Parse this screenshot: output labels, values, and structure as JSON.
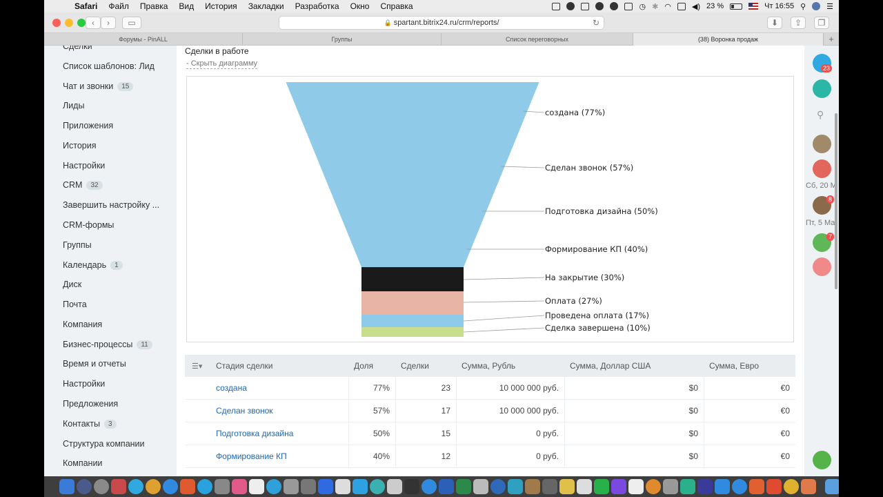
{
  "menubar": {
    "items": [
      "Safari",
      "Файл",
      "Правка",
      "Вид",
      "История",
      "Закладки",
      "Разработка",
      "Окно",
      "Справка"
    ],
    "battery": "23 %",
    "clock": "Чт 16:55"
  },
  "browser": {
    "url": "spartant.bitrix24.ru/crm/reports/",
    "tabs": [
      "Форумы - PinALL",
      "Группы",
      "Список переговорных",
      "(38) Воронка продаж"
    ]
  },
  "sidebar": {
    "items": [
      {
        "label": "Сделки",
        "count": null
      },
      {
        "label": "Список шаблонов: Лид",
        "count": null
      },
      {
        "label": "Чат и звонки",
        "count": "15"
      },
      {
        "label": "Лиды",
        "count": null
      },
      {
        "label": "Приложения",
        "count": null
      },
      {
        "label": "История",
        "count": null
      },
      {
        "label": "Настройки",
        "count": null
      },
      {
        "label": "CRM",
        "count": "32"
      },
      {
        "label": "Завершить настройку ...",
        "count": null
      },
      {
        "label": "CRM-формы",
        "count": null
      },
      {
        "label": "Группы",
        "count": null
      },
      {
        "label": "Календарь",
        "count": "1"
      },
      {
        "label": "Диск",
        "count": null
      },
      {
        "label": "Почта",
        "count": null
      },
      {
        "label": "Компания",
        "count": null
      },
      {
        "label": "Бизнес-процессы",
        "count": "11"
      },
      {
        "label": "Время и отчеты",
        "count": null
      },
      {
        "label": "Настройки",
        "count": null
      },
      {
        "label": "Предложения",
        "count": null
      },
      {
        "label": "Контакты",
        "count": "3"
      },
      {
        "label": "Структура компании",
        "count": null
      },
      {
        "label": "Компании",
        "count": null
      }
    ]
  },
  "report": {
    "title": "Сделки в работе",
    "hide_chart": "- Скрыть диаграмму"
  },
  "chart_data": {
    "type": "funnel",
    "stages": [
      {
        "label": "создана (77%)",
        "percent": 77,
        "color": "#8fcbe8"
      },
      {
        "label": "Сделан звонок (57%)",
        "percent": 57,
        "color": "#8fcbe8"
      },
      {
        "label": "Подготовка дизайна (50%)",
        "percent": 50,
        "color": "#8fcbe8"
      },
      {
        "label": "Формирование КП (40%)",
        "percent": 40,
        "color": "#8fcbe8"
      },
      {
        "label": "На закрытие (30%)",
        "percent": 30,
        "color": "#1a1a1a"
      },
      {
        "label": "Оплата (27%)",
        "percent": 27,
        "color": "#e8b4a6"
      },
      {
        "label": "Проведена оплата (17%)",
        "percent": 17,
        "color": "#8fcbe8"
      },
      {
        "label": "Сделка завершена (10%)",
        "percent": 10,
        "color": "#c8de8c"
      }
    ]
  },
  "table": {
    "headers": [
      "Стадия сделки",
      "Доля",
      "Сделки",
      "Сумма, Рубль",
      "Сумма, Доллар США",
      "Сумма, Евро"
    ],
    "rows": [
      [
        "создана",
        "77%",
        "23",
        "10 000 000 руб.",
        "$0",
        "€0"
      ],
      [
        "Сделан звонок",
        "57%",
        "17",
        "10 000 000 руб.",
        "$0",
        "€0"
      ],
      [
        "Подготовка дизайна",
        "50%",
        "15",
        "0 руб.",
        "$0",
        "€0"
      ],
      [
        "Формирование КП",
        "40%",
        "12",
        "0 руб.",
        "$0",
        "€0"
      ]
    ]
  },
  "rightbar": {
    "notif_count": "23",
    "date1": "Сб, 20 М",
    "date2": "Пт, 5 Ма",
    "badge1": "8",
    "badge2": "7"
  },
  "colors": {
    "accent_blue": "#2067b0",
    "funnel_blue": "#8fcbe8"
  }
}
